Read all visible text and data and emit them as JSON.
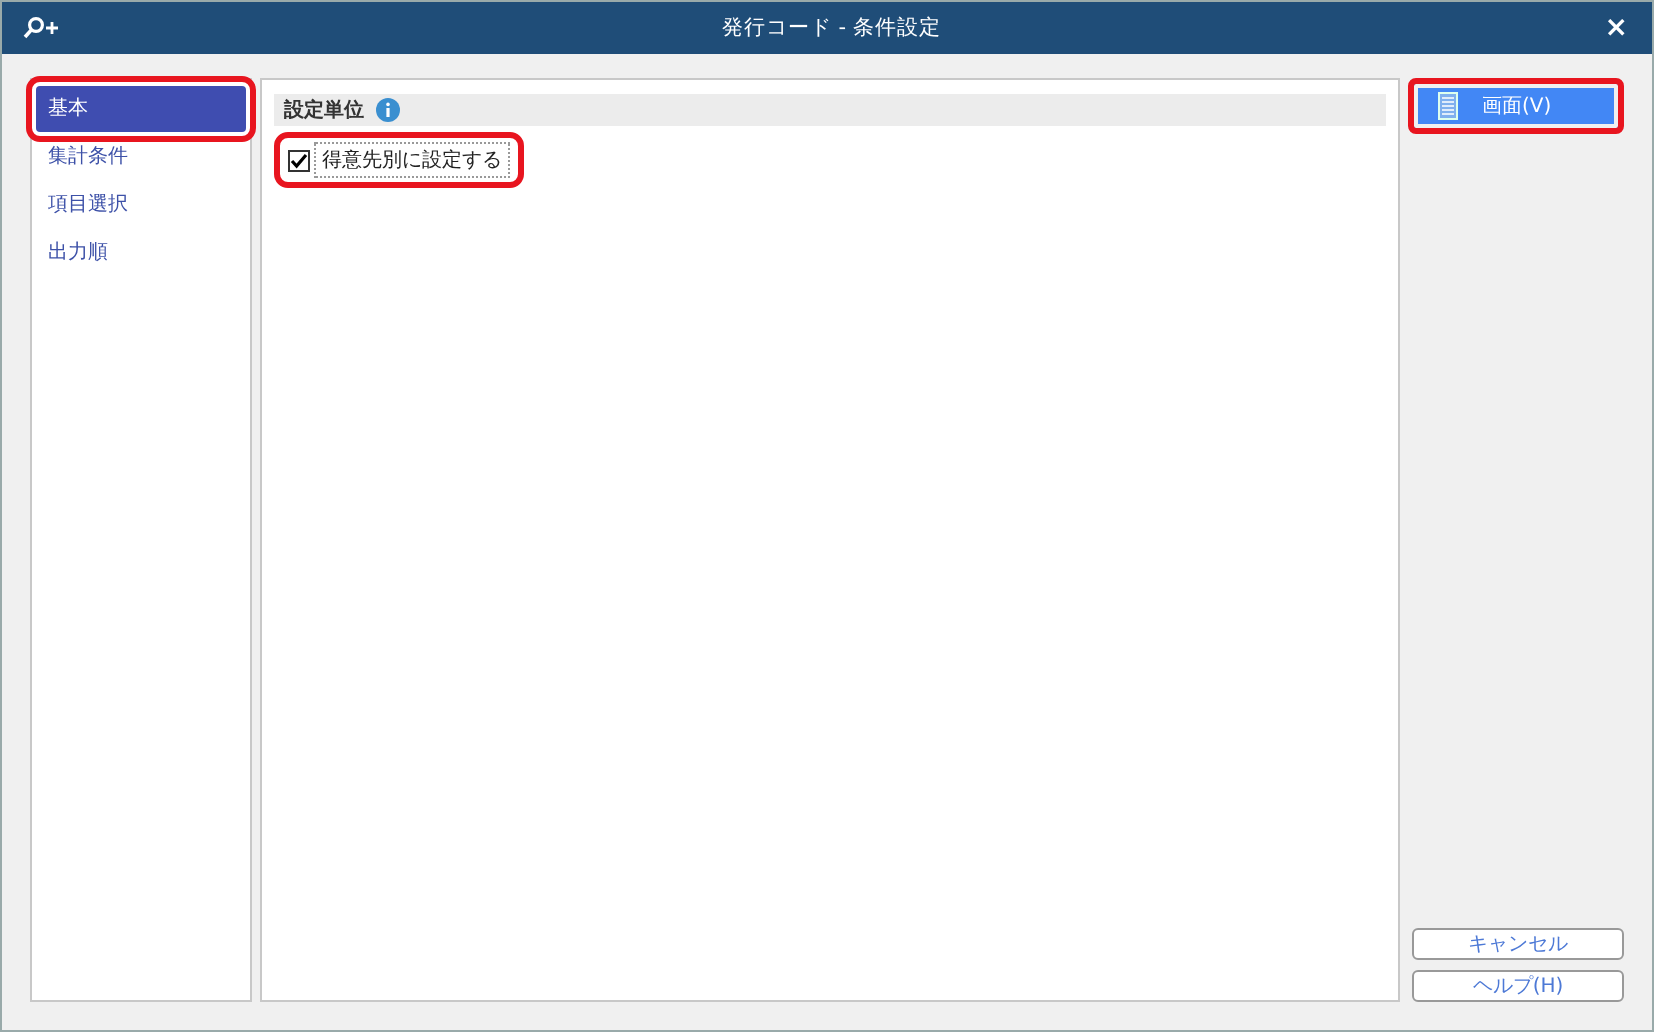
{
  "window": {
    "title": "発行コード - 条件設定",
    "close": "×"
  },
  "sidebar": {
    "items": [
      {
        "label": "基本",
        "selected": true,
        "highlighted": true
      },
      {
        "label": "集計条件",
        "selected": false,
        "highlighted": false
      },
      {
        "label": "項目選択",
        "selected": false,
        "highlighted": false
      },
      {
        "label": "出力順",
        "selected": false,
        "highlighted": false
      }
    ]
  },
  "section": {
    "title": "設定単位",
    "checkbox": {
      "label": "得意先別に設定する",
      "checked": true,
      "highlighted": true
    }
  },
  "buttons": [
    {
      "label": "画面(V)",
      "kind": "primary",
      "highlighted": true
    },
    {
      "label": "キャンセル",
      "kind": "secondary",
      "highlighted": false
    },
    {
      "label": "ヘルプ(H)",
      "kind": "secondary",
      "highlighted": false
    }
  ]
}
